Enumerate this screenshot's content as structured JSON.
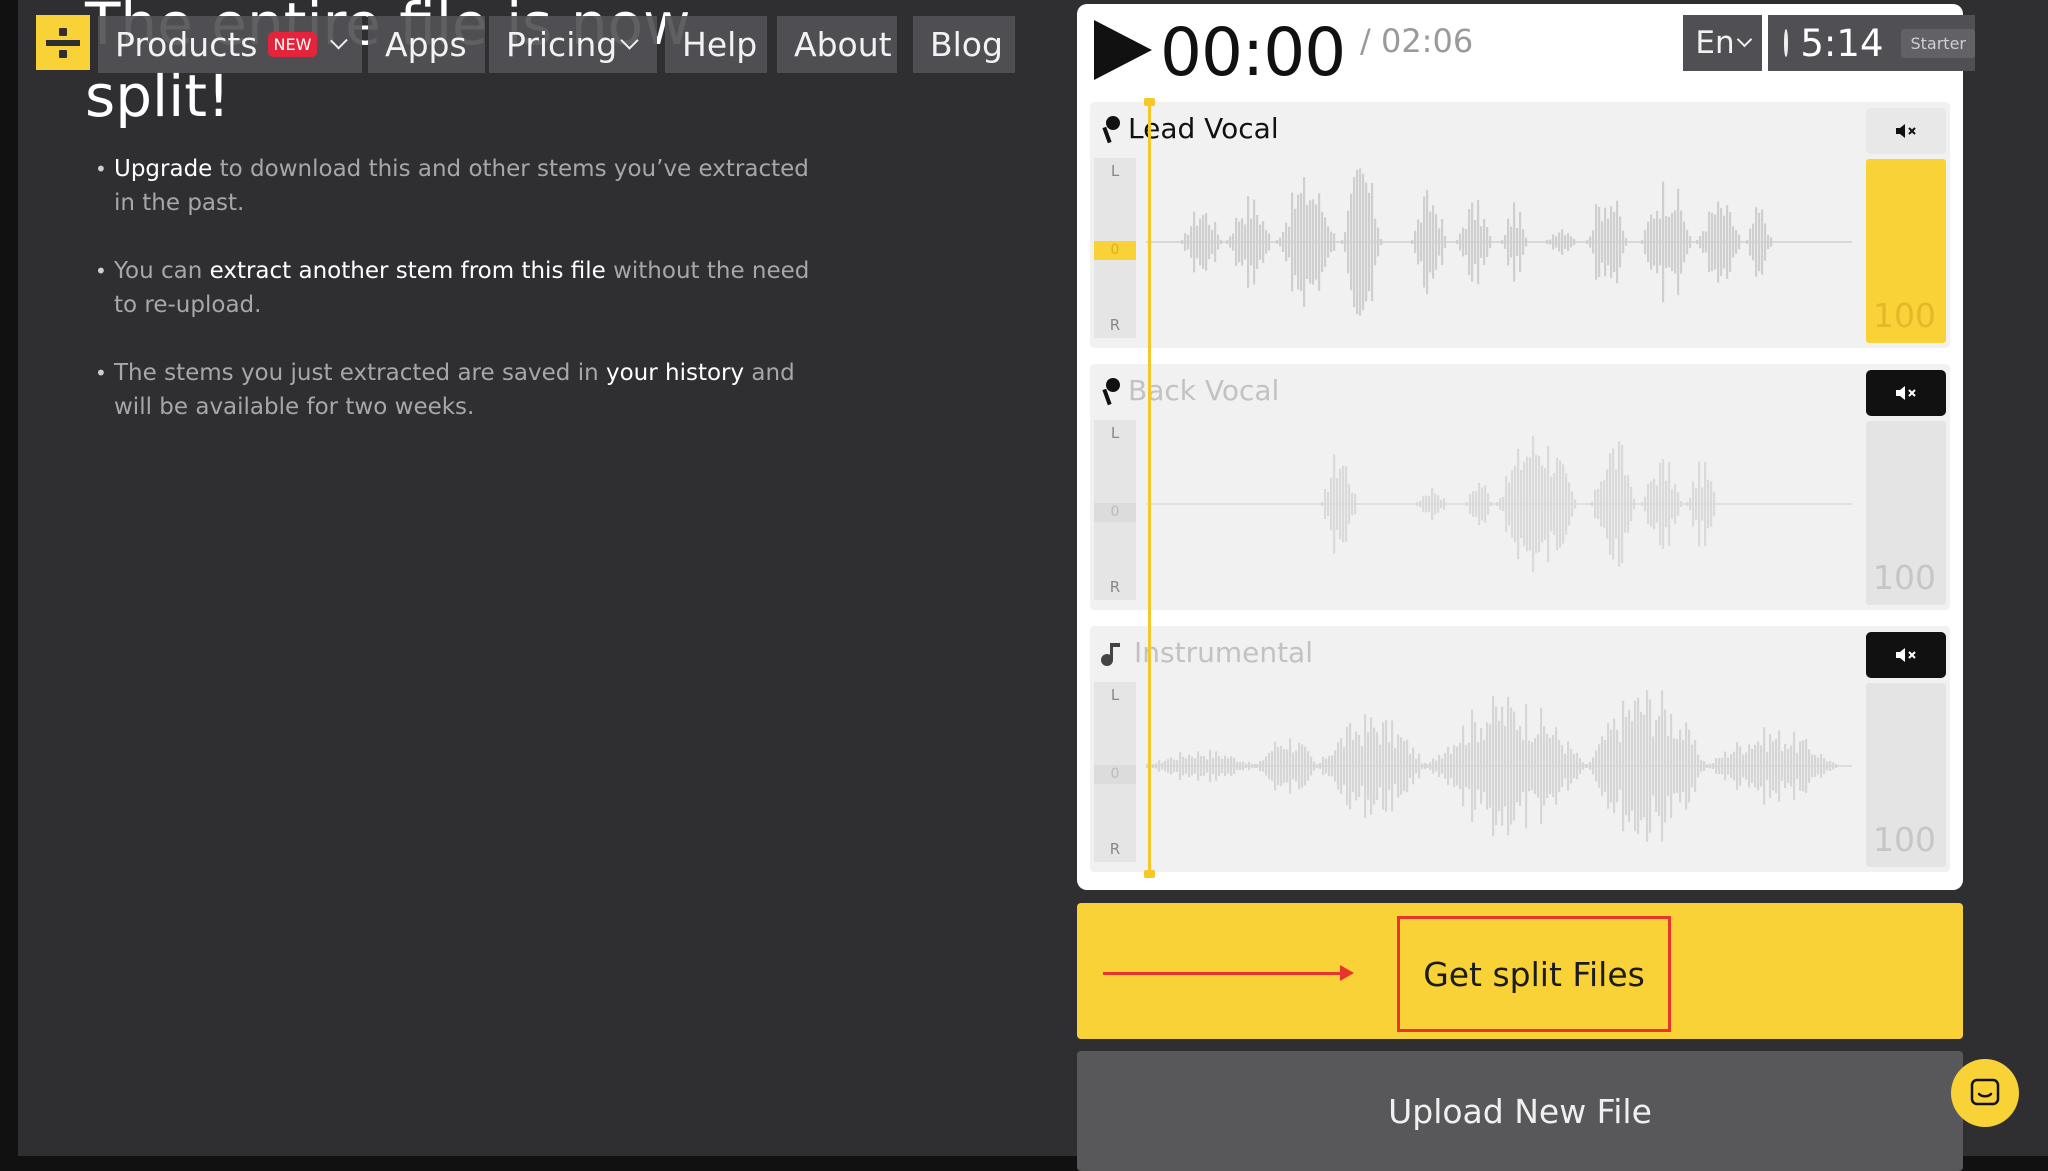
{
  "headline": "The entire file is now split!",
  "bullets": [
    {
      "em": "Upgrade",
      "rest": " to download this and other stems you’ve extracted in the past."
    },
    {
      "pre": "You can ",
      "em": "extract another stem from this file",
      "rest": " without the need to re-upload."
    },
    {
      "pre": "The stems you just extracted are saved in ",
      "em": "your history",
      "rest": " and will be available for two weeks."
    }
  ],
  "nav": {
    "products": "Products",
    "products_badge": "NEW",
    "apps": "Apps",
    "pricing": "Pricing",
    "help": "Help",
    "about": "About",
    "blog": "Blog"
  },
  "player": {
    "current_time": "00:00",
    "total_time": "/ 02:06",
    "language": "En",
    "timer": "5:14",
    "plan": "Starter"
  },
  "tracks": [
    {
      "name": "Lead Vocal",
      "volume": "100",
      "muted": false,
      "pan_l": "L",
      "pan_zero": "0",
      "pan_r": "R"
    },
    {
      "name": "Back Vocal",
      "volume": "100",
      "muted": true,
      "pan_l": "L",
      "pan_zero": "0",
      "pan_r": "R"
    },
    {
      "name": "Instrumental",
      "volume": "100",
      "muted": true,
      "pan_l": "L",
      "pan_zero": "0",
      "pan_r": "R"
    }
  ],
  "actions": {
    "get_split": "Get split Files",
    "upload_new": "Upload New File"
  },
  "colors": {
    "accent": "#f8d237",
    "annotation": "#e8342a",
    "background": "#2f2e31"
  }
}
